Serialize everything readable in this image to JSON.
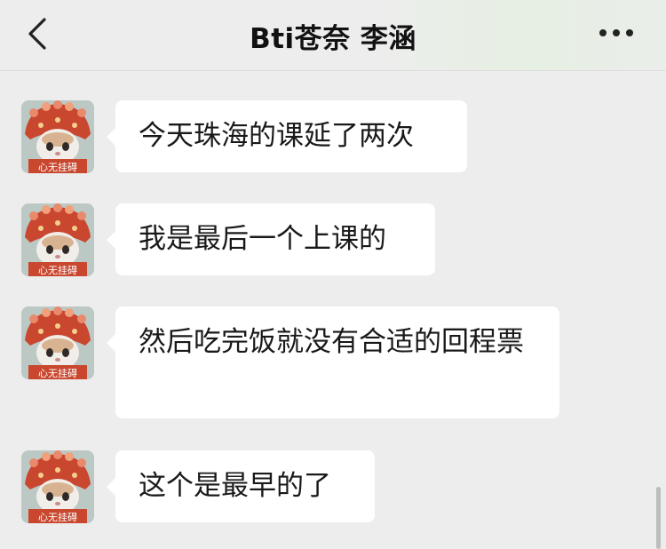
{
  "header": {
    "title": "Bti苍奈 李涵",
    "back_icon": "chevron-left-icon",
    "more_icon": "more-dots-icon"
  },
  "avatar_caption": "心无挂碍",
  "messages": [
    {
      "sender": "contact",
      "text": "今天珠海的课延了两次"
    },
    {
      "sender": "contact",
      "text": "我是最后一个上课的"
    },
    {
      "sender": "contact",
      "text": "然后吃完饭就没有合适的回程票"
    },
    {
      "sender": "contact",
      "text": "这个是最早的了"
    }
  ],
  "colors": {
    "background": "#ededed",
    "bubble": "#ffffff",
    "text": "#191919",
    "avatar_red": "#c9472f"
  }
}
